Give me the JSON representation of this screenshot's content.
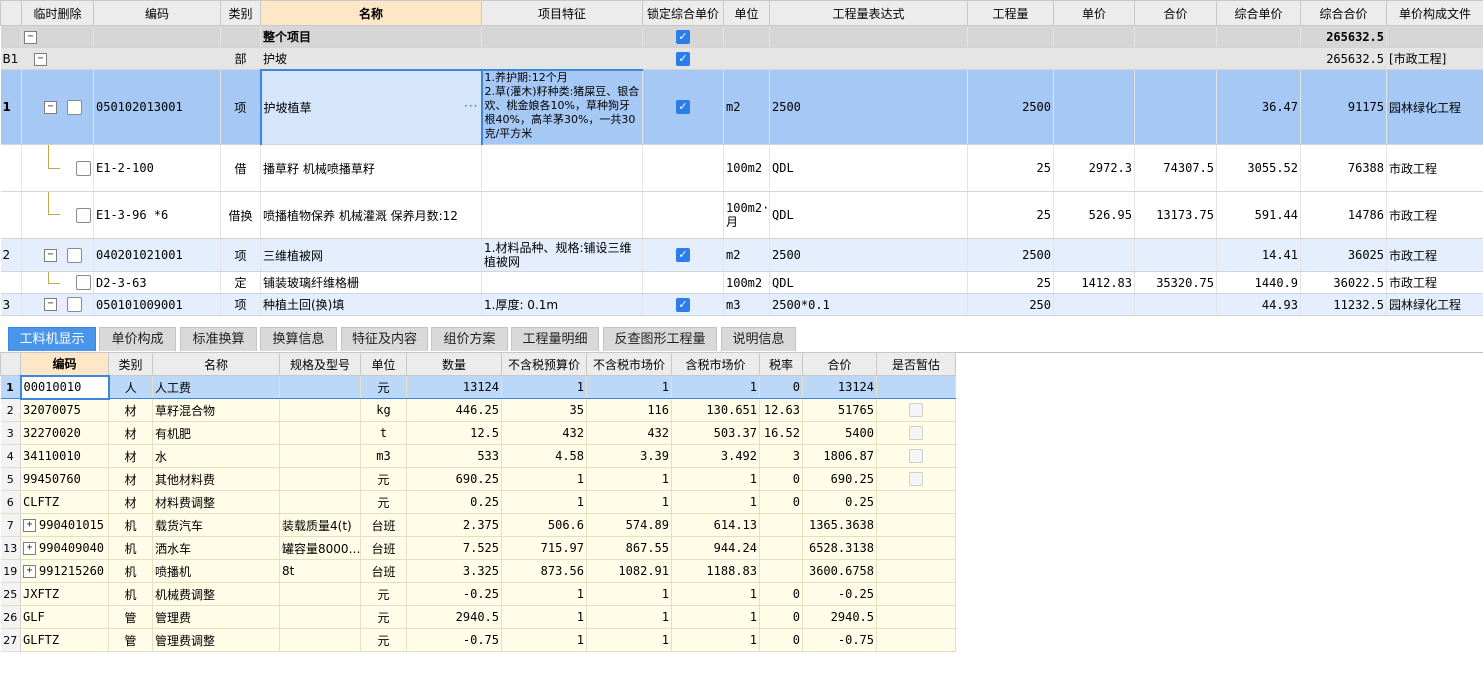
{
  "top_grid": {
    "columns": [
      "临时删除",
      "编码",
      "类别",
      "名称",
      "项目特征",
      "锁定综合单价",
      "单位",
      "工程量表达式",
      "工程量",
      "单价",
      "合价",
      "综合单价",
      "综合合价",
      "单价构成文件"
    ],
    "rows": [
      {
        "num": "",
        "code": "",
        "type": "",
        "name": "整个项目",
        "feature": "",
        "locked": true,
        "unit": "",
        "expr": "",
        "qty": "",
        "price": "",
        "total": "",
        "comp_price": "",
        "comp_total": "265632.5",
        "file": ""
      },
      {
        "num": "B1",
        "code": "",
        "type": "部",
        "name": "护坡",
        "feature": "",
        "locked": true,
        "unit": "",
        "expr": "",
        "qty": "",
        "price": "",
        "total": "",
        "comp_price": "",
        "comp_total": "265632.5",
        "file": "[市政工程]"
      },
      {
        "num": "1",
        "code": "050102013001",
        "type": "项",
        "name": "护坡植草",
        "feature": "1.养护期:12个月\n2.草(灌木)籽种类:猪屎豆、银合欢、桃金娘各10%，草种狗牙根40%，高羊茅30%，一共30克/平方米",
        "locked": true,
        "unit": "m2",
        "expr": "2500",
        "qty": "2500",
        "price": "",
        "total": "",
        "comp_price": "36.47",
        "comp_total": "91175",
        "file": "园林绿化工程"
      },
      {
        "num": "",
        "code": "E1-2-100",
        "type": "借",
        "name": "播草籽 机械喷播草籽",
        "feature": "",
        "locked": false,
        "unit": "100m2",
        "expr": "QDL",
        "qty": "25",
        "price": "2972.3",
        "total": "74307.5",
        "comp_price": "3055.52",
        "comp_total": "76388",
        "file": "市政工程"
      },
      {
        "num": "",
        "code": "E1-3-96 *6",
        "type": "借换",
        "name": "喷播植物保养 机械灌溉  保养月数:12",
        "feature": "",
        "locked": false,
        "unit": "100m2·月",
        "expr": "QDL",
        "qty": "25",
        "price": "526.95",
        "total": "13173.75",
        "comp_price": "591.44",
        "comp_total": "14786",
        "file": "市政工程"
      },
      {
        "num": "2",
        "code": "040201021001",
        "type": "项",
        "name": "三维植被网",
        "feature": "1.材料品种、规格:铺设三维植被网",
        "locked": true,
        "unit": "m2",
        "expr": "2500",
        "qty": "2500",
        "price": "",
        "total": "",
        "comp_price": "14.41",
        "comp_total": "36025",
        "file": "市政工程"
      },
      {
        "num": "",
        "code": "D2-3-63",
        "type": "定",
        "name": "铺装玻璃纤维格栅",
        "feature": "",
        "locked": false,
        "unit": "100m2",
        "expr": "QDL",
        "qty": "25",
        "price": "1412.83",
        "total": "35320.75",
        "comp_price": "1440.9",
        "comp_total": "36022.5",
        "file": "市政工程"
      },
      {
        "num": "3",
        "code": "050101009001",
        "type": "项",
        "name": "种植土回(换)填",
        "feature": "1.厚度: 0.1m",
        "locked": true,
        "unit": "m3",
        "expr": "2500*0.1",
        "qty": "250",
        "price": "",
        "total": "",
        "comp_price": "44.93",
        "comp_total": "11232.5",
        "file": "园林绿化工程"
      }
    ]
  },
  "tabs": [
    "工料机显示",
    "单价构成",
    "标准换算",
    "换算信息",
    "特征及内容",
    "组价方案",
    "工程量明细",
    "反查图形工程量",
    "说明信息"
  ],
  "bottom_grid": {
    "columns": [
      "编码",
      "类别",
      "名称",
      "规格及型号",
      "单位",
      "数量",
      "不含税预算价",
      "不含税市场价",
      "含税市场价",
      "税率",
      "合价",
      "是否暂估"
    ],
    "rows": [
      {
        "num": "1",
        "code": "00010010",
        "type": "人",
        "name": "人工费",
        "spec": "",
        "unit": "元",
        "qty": "13124",
        "pre": "1",
        "mkt": "1",
        "tax_mkt": "1",
        "rate": "0",
        "total": "13124",
        "estimate": false,
        "expand": false
      },
      {
        "num": "2",
        "code": "32070075",
        "type": "材",
        "name": "草籽混合物",
        "spec": "",
        "unit": "kg",
        "qty": "446.25",
        "pre": "35",
        "mkt": "116",
        "tax_mkt": "130.651",
        "rate": "12.63",
        "total": "51765",
        "estimate": true,
        "expand": false
      },
      {
        "num": "3",
        "code": "32270020",
        "type": "材",
        "name": "有机肥",
        "spec": "",
        "unit": "t",
        "qty": "12.5",
        "pre": "432",
        "mkt": "432",
        "tax_mkt": "503.37",
        "rate": "16.52",
        "total": "5400",
        "estimate": true,
        "expand": false
      },
      {
        "num": "4",
        "code": "34110010",
        "type": "材",
        "name": "水",
        "spec": "",
        "unit": "m3",
        "qty": "533",
        "pre": "4.58",
        "mkt": "3.39",
        "tax_mkt": "3.492",
        "rate": "3",
        "total": "1806.87",
        "estimate": true,
        "expand": false
      },
      {
        "num": "5",
        "code": "99450760",
        "type": "材",
        "name": "其他材料费",
        "spec": "",
        "unit": "元",
        "qty": "690.25",
        "pre": "1",
        "mkt": "1",
        "tax_mkt": "1",
        "rate": "0",
        "total": "690.25",
        "estimate": true,
        "expand": false
      },
      {
        "num": "6",
        "code": "CLFTZ",
        "type": "材",
        "name": "材料费调整",
        "spec": "",
        "unit": "元",
        "qty": "0.25",
        "pre": "1",
        "mkt": "1",
        "tax_mkt": "1",
        "rate": "0",
        "total": "0.25",
        "estimate": false,
        "expand": false
      },
      {
        "num": "7",
        "code": "990401015",
        "type": "机",
        "name": "载货汽车",
        "spec": "装载质量4(t)",
        "unit": "台班",
        "qty": "2.375",
        "pre": "506.6",
        "mkt": "574.89",
        "tax_mkt": "614.13",
        "rate": "",
        "total": "1365.3638",
        "estimate": false,
        "expand": true
      },
      {
        "num": "13",
        "code": "990409040",
        "type": "机",
        "name": "洒水车",
        "spec": "罐容量8000…",
        "unit": "台班",
        "qty": "7.525",
        "pre": "715.97",
        "mkt": "867.55",
        "tax_mkt": "944.24",
        "rate": "",
        "total": "6528.3138",
        "estimate": false,
        "expand": true
      },
      {
        "num": "19",
        "code": "991215260",
        "type": "机",
        "name": "喷播机",
        "spec": "8t",
        "unit": "台班",
        "qty": "3.325",
        "pre": "873.56",
        "mkt": "1082.91",
        "tax_mkt": "1188.83",
        "rate": "",
        "total": "3600.6758",
        "estimate": false,
        "expand": true
      },
      {
        "num": "25",
        "code": "JXFTZ",
        "type": "机",
        "name": "机械费调整",
        "spec": "",
        "unit": "元",
        "qty": "-0.25",
        "pre": "1",
        "mkt": "1",
        "tax_mkt": "1",
        "rate": "0",
        "total": "-0.25",
        "estimate": false,
        "expand": false
      },
      {
        "num": "26",
        "code": "GLF",
        "type": "管",
        "name": "管理费",
        "spec": "",
        "unit": "元",
        "qty": "2940.5",
        "pre": "1",
        "mkt": "1",
        "tax_mkt": "1",
        "rate": "0",
        "total": "2940.5",
        "estimate": false,
        "expand": false
      },
      {
        "num": "27",
        "code": "GLFTZ",
        "type": "管",
        "name": "管理费调整",
        "spec": "",
        "unit": "元",
        "qty": "-0.75",
        "pre": "1",
        "mkt": "1",
        "tax_mkt": "1",
        "rate": "0",
        "total": "-0.75",
        "estimate": false,
        "expand": false
      }
    ]
  },
  "icons": {
    "collapse": "minus-box-icon",
    "expand": "plus-box-icon",
    "checked": "check-icon",
    "more": "ellipsis-icon"
  },
  "colors": {
    "selected_row": "#a6c8f5",
    "active_tab": "#4a95ec",
    "bottom_row": "#fffde7",
    "header_active": "#fde7c6"
  }
}
